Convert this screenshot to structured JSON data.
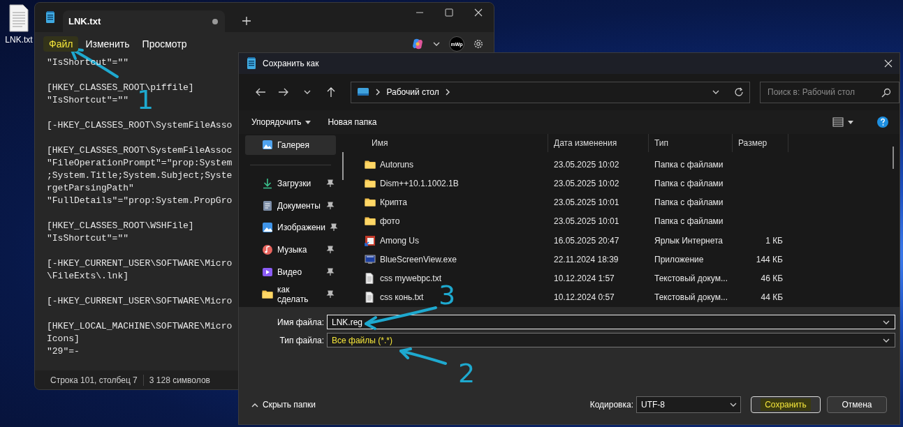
{
  "desktop_icons": [
    {
      "label": "LNK.txt"
    }
  ],
  "notepad": {
    "tabs": [
      {
        "title": "LNK.txt",
        "selected": true,
        "unsaved": true
      }
    ],
    "menu": [
      {
        "label": "Файл",
        "highlighted": true
      },
      {
        "label": "Изменить",
        "highlighted": false
      },
      {
        "label": "Просмотр",
        "highlighted": false
      }
    ],
    "avatar_text": "mWp",
    "blocks": [
      [
        "\"IsShortcut\"=\"\""
      ],
      [
        "[HKEY_CLASSES_ROOT\\piffile]",
        "\"IsShortcut\"=\"\""
      ],
      [
        "[-HKEY_CLASSES_ROOT\\SystemFileAsso"
      ],
      [
        "[HKEY_CLASSES_ROOT\\SystemFileAssoc",
        "\"FileOperationPrompt\"=\"prop:System",
        ";System.Title;System.Subject;Syste",
        "rgetParsingPath\"",
        "\"FullDetails\"=\"prop:System.PropGro"
      ],
      [
        "[HKEY_CLASSES_ROOT\\WSHFile]",
        "\"IsShortcut\"=\"\""
      ],
      [
        "[-HKEY_CURRENT_USER\\SOFTWARE\\Micro",
        "\\FileExts\\.lnk]"
      ],
      [
        "[-HKEY_CURRENT_USER\\SOFTWARE\\Micro"
      ],
      [
        "[HKEY_LOCAL_MACHINE\\SOFTWARE\\Micro",
        "Icons]",
        "\"29\"=-"
      ]
    ],
    "status_bar": [
      "Строка 101, столбец 7",
      "3 128 символов"
    ]
  },
  "dialog": {
    "title": "Сохранить как",
    "address": [
      "Рабочий стол"
    ],
    "search": {
      "placeholder": "Поиск в: Рабочий стол"
    },
    "toolbar": {
      "organize": "Упорядочить",
      "new_folder": "Новая папка"
    },
    "nav": [
      {
        "kind": "gallery",
        "label": "Галерея",
        "selected": true,
        "pinned": false,
        "divider_after": true
      },
      {
        "kind": "downloads",
        "label": "Загрузки",
        "selected": false,
        "pinned": true,
        "divider_after": false
      },
      {
        "kind": "documents",
        "label": "Документы",
        "selected": false,
        "pinned": true,
        "divider_after": false
      },
      {
        "kind": "pictures",
        "label": "Изображени",
        "selected": false,
        "pinned": true,
        "divider_after": false
      },
      {
        "kind": "music",
        "label": "Музыка",
        "selected": false,
        "pinned": true,
        "divider_after": false
      },
      {
        "kind": "video",
        "label": "Видео",
        "selected": false,
        "pinned": true,
        "divider_after": false
      },
      {
        "kind": "folder",
        "label": "как сделать",
        "selected": false,
        "pinned": true,
        "divider_after": false
      }
    ],
    "columns": [
      "Имя",
      "Дата изменения",
      "Тип",
      "Размер"
    ],
    "rows": [
      {
        "kind": "folder",
        "name": "Autoruns",
        "date": "23.05.2025 10:02",
        "type": "Папка с файлами"
      },
      {
        "kind": "folder",
        "name": "Dism++10.1.1002.1B",
        "date": "23.05.2025 10:02",
        "type": "Папка с файлами"
      },
      {
        "kind": "folder",
        "name": "Крипта",
        "date": "23.05.2025 10:01",
        "type": "Папка с файлами"
      },
      {
        "kind": "folder",
        "name": "фото",
        "date": "23.05.2025 10:01",
        "type": "Папка с файлами"
      },
      {
        "kind": "shortcut",
        "name": "Among Us",
        "date": "16.05.2025 20:47",
        "type": "Ярлык Интернета",
        "size": "1 КБ"
      },
      {
        "kind": "exe",
        "name": "BlueScreenView.exe",
        "date": "22.11.2024 18:39",
        "type": "Приложение",
        "size": "144 КБ"
      },
      {
        "kind": "text",
        "name": "css mywebpc.txt",
        "date": "10.12.2024 1:57",
        "type": "Текстовый докум...",
        "size": "46 КБ"
      },
      {
        "kind": "text",
        "name": "css конь.txt",
        "date": "10.12.2024 0:57",
        "type": "Текстовый докум...",
        "size": "44 КБ"
      }
    ],
    "file_name": {
      "label": "Имя файла:",
      "value": "LNK.reg"
    },
    "file_type": {
      "label": "Тип файла:",
      "value": "Все файлы  (*.*)",
      "highlighted": true
    },
    "hide_folders": "Скрыть папки",
    "encoding": {
      "label": "Кодировка:",
      "value": "UTF-8"
    },
    "buttons": [
      {
        "label": "Сохранить",
        "highlighted": true
      },
      {
        "label": "Отмена",
        "highlighted": false
      }
    ]
  },
  "annotations": [
    {
      "label": "1"
    },
    {
      "label": "3"
    },
    {
      "label": "2"
    }
  ]
}
